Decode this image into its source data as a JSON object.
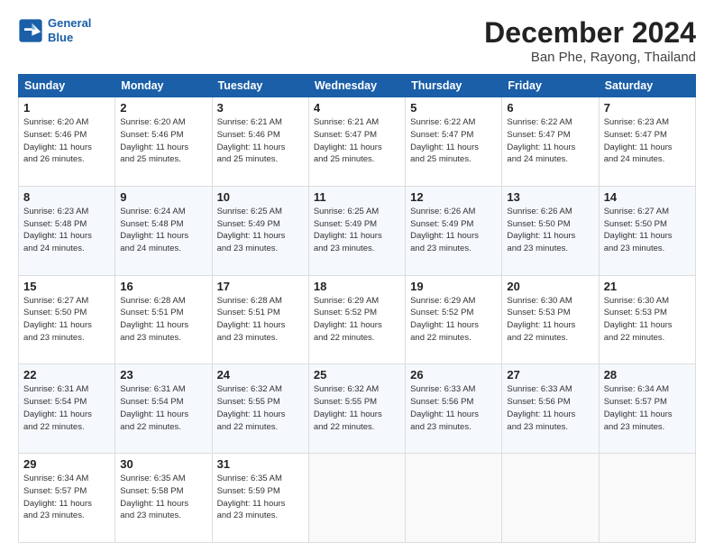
{
  "header": {
    "logo_line1": "General",
    "logo_line2": "Blue",
    "month": "December 2024",
    "location": "Ban Phe, Rayong, Thailand"
  },
  "days_of_week": [
    "Sunday",
    "Monday",
    "Tuesday",
    "Wednesday",
    "Thursday",
    "Friday",
    "Saturday"
  ],
  "weeks": [
    [
      {
        "day": "1",
        "info": "Sunrise: 6:20 AM\nSunset: 5:46 PM\nDaylight: 11 hours\nand 26 minutes."
      },
      {
        "day": "2",
        "info": "Sunrise: 6:20 AM\nSunset: 5:46 PM\nDaylight: 11 hours\nand 25 minutes."
      },
      {
        "day": "3",
        "info": "Sunrise: 6:21 AM\nSunset: 5:46 PM\nDaylight: 11 hours\nand 25 minutes."
      },
      {
        "day": "4",
        "info": "Sunrise: 6:21 AM\nSunset: 5:47 PM\nDaylight: 11 hours\nand 25 minutes."
      },
      {
        "day": "5",
        "info": "Sunrise: 6:22 AM\nSunset: 5:47 PM\nDaylight: 11 hours\nand 25 minutes."
      },
      {
        "day": "6",
        "info": "Sunrise: 6:22 AM\nSunset: 5:47 PM\nDaylight: 11 hours\nand 24 minutes."
      },
      {
        "day": "7",
        "info": "Sunrise: 6:23 AM\nSunset: 5:47 PM\nDaylight: 11 hours\nand 24 minutes."
      }
    ],
    [
      {
        "day": "8",
        "info": "Sunrise: 6:23 AM\nSunset: 5:48 PM\nDaylight: 11 hours\nand 24 minutes."
      },
      {
        "day": "9",
        "info": "Sunrise: 6:24 AM\nSunset: 5:48 PM\nDaylight: 11 hours\nand 24 minutes."
      },
      {
        "day": "10",
        "info": "Sunrise: 6:25 AM\nSunset: 5:49 PM\nDaylight: 11 hours\nand 23 minutes."
      },
      {
        "day": "11",
        "info": "Sunrise: 6:25 AM\nSunset: 5:49 PM\nDaylight: 11 hours\nand 23 minutes."
      },
      {
        "day": "12",
        "info": "Sunrise: 6:26 AM\nSunset: 5:49 PM\nDaylight: 11 hours\nand 23 minutes."
      },
      {
        "day": "13",
        "info": "Sunrise: 6:26 AM\nSunset: 5:50 PM\nDaylight: 11 hours\nand 23 minutes."
      },
      {
        "day": "14",
        "info": "Sunrise: 6:27 AM\nSunset: 5:50 PM\nDaylight: 11 hours\nand 23 minutes."
      }
    ],
    [
      {
        "day": "15",
        "info": "Sunrise: 6:27 AM\nSunset: 5:50 PM\nDaylight: 11 hours\nand 23 minutes."
      },
      {
        "day": "16",
        "info": "Sunrise: 6:28 AM\nSunset: 5:51 PM\nDaylight: 11 hours\nand 23 minutes."
      },
      {
        "day": "17",
        "info": "Sunrise: 6:28 AM\nSunset: 5:51 PM\nDaylight: 11 hours\nand 23 minutes."
      },
      {
        "day": "18",
        "info": "Sunrise: 6:29 AM\nSunset: 5:52 PM\nDaylight: 11 hours\nand 22 minutes."
      },
      {
        "day": "19",
        "info": "Sunrise: 6:29 AM\nSunset: 5:52 PM\nDaylight: 11 hours\nand 22 minutes."
      },
      {
        "day": "20",
        "info": "Sunrise: 6:30 AM\nSunset: 5:53 PM\nDaylight: 11 hours\nand 22 minutes."
      },
      {
        "day": "21",
        "info": "Sunrise: 6:30 AM\nSunset: 5:53 PM\nDaylight: 11 hours\nand 22 minutes."
      }
    ],
    [
      {
        "day": "22",
        "info": "Sunrise: 6:31 AM\nSunset: 5:54 PM\nDaylight: 11 hours\nand 22 minutes."
      },
      {
        "day": "23",
        "info": "Sunrise: 6:31 AM\nSunset: 5:54 PM\nDaylight: 11 hours\nand 22 minutes."
      },
      {
        "day": "24",
        "info": "Sunrise: 6:32 AM\nSunset: 5:55 PM\nDaylight: 11 hours\nand 22 minutes."
      },
      {
        "day": "25",
        "info": "Sunrise: 6:32 AM\nSunset: 5:55 PM\nDaylight: 11 hours\nand 22 minutes."
      },
      {
        "day": "26",
        "info": "Sunrise: 6:33 AM\nSunset: 5:56 PM\nDaylight: 11 hours\nand 23 minutes."
      },
      {
        "day": "27",
        "info": "Sunrise: 6:33 AM\nSunset: 5:56 PM\nDaylight: 11 hours\nand 23 minutes."
      },
      {
        "day": "28",
        "info": "Sunrise: 6:34 AM\nSunset: 5:57 PM\nDaylight: 11 hours\nand 23 minutes."
      }
    ],
    [
      {
        "day": "29",
        "info": "Sunrise: 6:34 AM\nSunset: 5:57 PM\nDaylight: 11 hours\nand 23 minutes."
      },
      {
        "day": "30",
        "info": "Sunrise: 6:35 AM\nSunset: 5:58 PM\nDaylight: 11 hours\nand 23 minutes."
      },
      {
        "day": "31",
        "info": "Sunrise: 6:35 AM\nSunset: 5:59 PM\nDaylight: 11 hours\nand 23 minutes."
      },
      null,
      null,
      null,
      null
    ]
  ]
}
